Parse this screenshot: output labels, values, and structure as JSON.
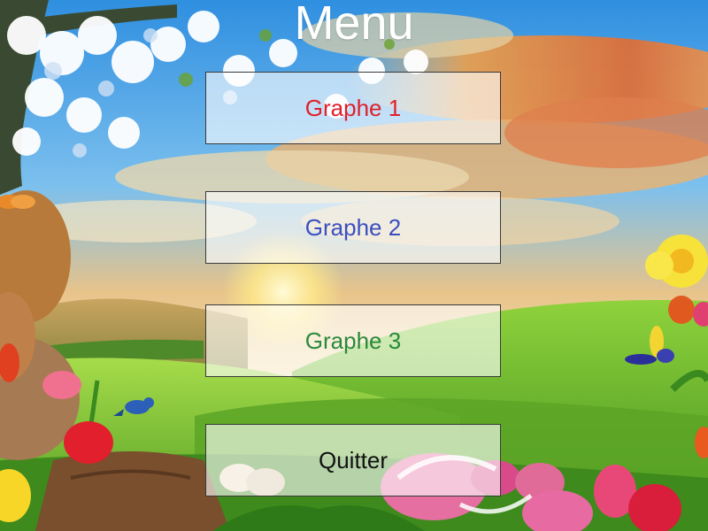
{
  "menu": {
    "title": "Menu",
    "buttons": [
      {
        "label": "Graphe 1",
        "color": "#e0202a"
      },
      {
        "label": "Graphe 2",
        "color": "#3a4fc0"
      },
      {
        "label": "Graphe 3",
        "color": "#2a8a3a"
      },
      {
        "label": "Quitter",
        "color": "#111111"
      }
    ]
  },
  "background": {
    "scene": "spring-easter-landscape",
    "sky_colors": [
      "#3aa2e8",
      "#f2b25a",
      "#e9763a"
    ],
    "grass_color": "#6ab82e"
  }
}
